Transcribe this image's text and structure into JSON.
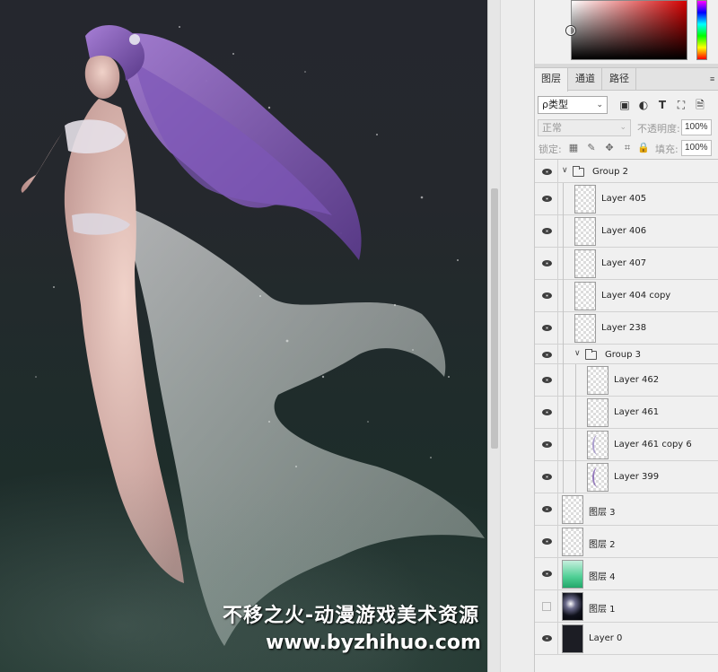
{
  "canvas": {
    "watermark_line1": "不移之火-动漫游戏美术资源",
    "watermark_line2": "www.byzhihuo.com"
  },
  "panel_tabs": [
    {
      "label": "图层",
      "active": true
    },
    {
      "label": "通道",
      "active": false
    },
    {
      "label": "路径",
      "active": false
    }
  ],
  "filter": {
    "kind_label": "ρ类型",
    "icons": [
      "image-filter-icon",
      "adjustment-filter-icon",
      "type-filter-icon",
      "shape-filter-icon",
      "smart-object-filter-icon"
    ]
  },
  "blend": {
    "mode": "正常",
    "opacity_label": "不透明度:",
    "opacity_value": "100%"
  },
  "lock": {
    "label": "锁定:",
    "fill_label": "填充:",
    "fill_value": "100%"
  },
  "layers": [
    {
      "name": "Group 2",
      "type": "group"
    },
    {
      "name": "Layer 405",
      "type": "layer"
    },
    {
      "name": "Layer 406",
      "type": "layer"
    },
    {
      "name": "Layer 407",
      "type": "layer"
    },
    {
      "name": "Layer 404 copy",
      "type": "layer"
    },
    {
      "name": "Layer 238",
      "type": "layer"
    },
    {
      "name": "Group 3",
      "type": "group"
    },
    {
      "name": "Layer 462",
      "type": "layer"
    },
    {
      "name": "Layer 461",
      "type": "layer"
    },
    {
      "name": "Layer 461 copy 6",
      "type": "layer"
    },
    {
      "name": "Layer 399",
      "type": "layer"
    },
    {
      "name": "图层 3",
      "type": "layer"
    },
    {
      "name": "图层 2",
      "type": "layer"
    },
    {
      "name": "图层 4",
      "type": "layer"
    },
    {
      "name": "图层 1",
      "type": "layer",
      "visible": false
    },
    {
      "name": "Layer 0",
      "type": "layer"
    }
  ],
  "colors": {
    "canvas_top": "#25272e",
    "canvas_bottom": "#1b3029",
    "hair": "#8a5fc0",
    "panel_bg": "#f0f0f0"
  }
}
